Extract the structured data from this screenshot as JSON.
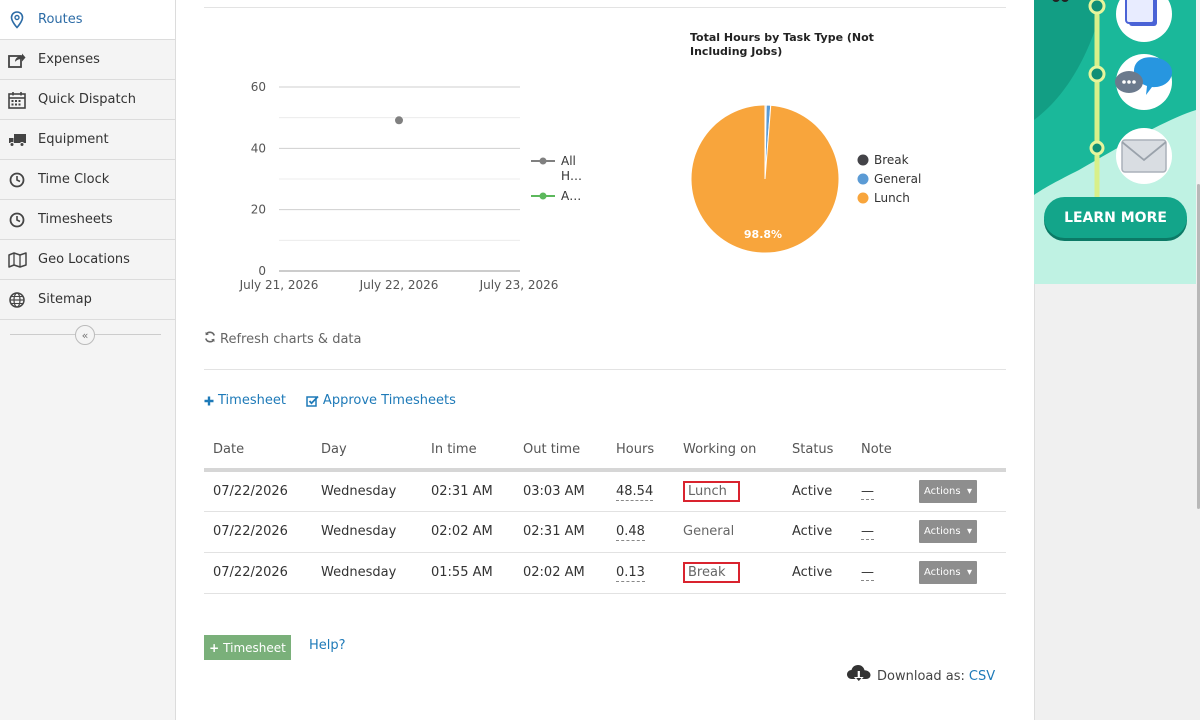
{
  "sidebar": {
    "items": [
      {
        "label": "Routes",
        "icon": "map-pin-icon",
        "active": true
      },
      {
        "label": "Expenses",
        "icon": "share-icon",
        "active": false
      },
      {
        "label": "Quick Dispatch",
        "icon": "calendar-icon",
        "active": false
      },
      {
        "label": "Equipment",
        "icon": "truck-icon",
        "active": false
      },
      {
        "label": "Time Clock",
        "icon": "clock-icon",
        "active": false
      },
      {
        "label": "Timesheets",
        "icon": "clock-icon",
        "active": false
      },
      {
        "label": "Geo Locations",
        "icon": "map-icon",
        "active": false
      },
      {
        "label": "Sitemap",
        "icon": "globe-icon",
        "active": false
      }
    ],
    "collapse_icon": "double-chevron-left-icon"
  },
  "chart_data": [
    {
      "type": "line",
      "x": [
        "July 21, 2026",
        "July 22, 2026",
        "July 23, 2026"
      ],
      "ylim": [
        0,
        60
      ],
      "yticks": [
        "0",
        "20",
        "40",
        "60"
      ],
      "series": [
        {
          "name": "All H…",
          "color": "#808080",
          "points": [
            {
              "x": "July 22, 2026",
              "y": 49.15
            }
          ]
        },
        {
          "name": "A…",
          "color": "#5cb85c",
          "points": []
        }
      ],
      "grid": true,
      "legend": "right"
    },
    {
      "type": "pie",
      "title": "Total Hours by Task Type (Not Including Jobs)",
      "slices": [
        {
          "label": "Break",
          "value": 0.13,
          "color": "#434348"
        },
        {
          "label": "General",
          "value": 0.48,
          "color": "#5b9bd5"
        },
        {
          "label": "Lunch",
          "value": 48.54,
          "color": "#f8a53c"
        }
      ],
      "data_labels": [
        "98.8%"
      ],
      "legend": "right"
    }
  ],
  "refresh_label": "Refresh charts & data",
  "actions": {
    "add_timesheet": "Timesheet",
    "approve": "Approve Timesheets"
  },
  "table": {
    "columns": [
      "Date",
      "Day",
      "In time",
      "Out time",
      "Hours",
      "Working on",
      "Status",
      "Note"
    ],
    "rows": [
      {
        "date": "07/22/2026",
        "day": "Wednesday",
        "in": "02:31 AM",
        "out": "03:03 AM",
        "hours": "48.54",
        "working_on": "Lunch",
        "status": "Active",
        "note": "—",
        "highlighted": true,
        "action": "Actions"
      },
      {
        "date": "07/22/2026",
        "day": "Wednesday",
        "in": "02:02 AM",
        "out": "02:31 AM",
        "hours": "0.48",
        "working_on": "General",
        "status": "Active",
        "note": "—",
        "highlighted": false,
        "action": "Actions"
      },
      {
        "date": "07/22/2026",
        "day": "Wednesday",
        "in": "01:55 AM",
        "out": "02:02 AM",
        "hours": "0.13",
        "working_on": "Break",
        "status": "Active",
        "note": "—",
        "highlighted": true,
        "action": "Actions"
      }
    ]
  },
  "add_button": "Timesheet",
  "help_link": "Help?",
  "download": {
    "label": "Download as:",
    "csv": "CSV"
  },
  "ad": {
    "button": "LEARN MORE"
  }
}
